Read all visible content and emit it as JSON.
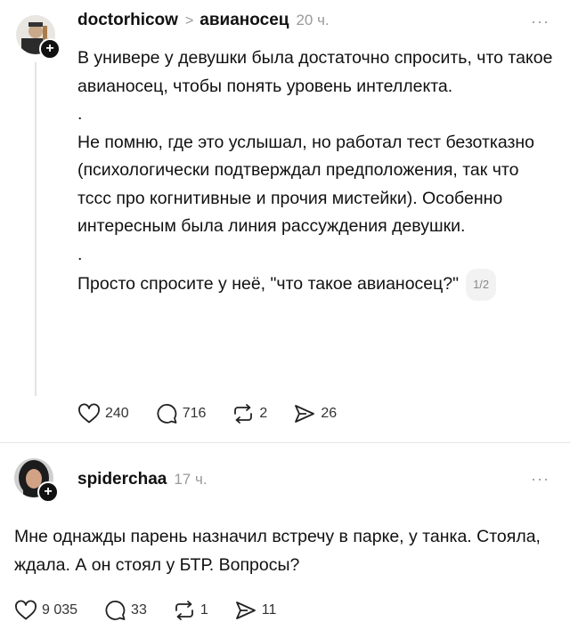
{
  "post": {
    "username": "doctorhicow",
    "chevron": ">",
    "topic": "авианосец",
    "time": "20 ч.",
    "more": "···",
    "paragraphs": [
      "В универе у девушки была достаточно спросить, что такое авианосец, чтобы понять уровень интеллекта.",
      ".",
      "Не помню, где это услышал, но работал тест безотказно (психологически подтверждал предположения, так что тссс про когнитивные и прочия мистейки). Особенно интересным была линия рассуждения девушки.",
      ".",
      "Просто спросите у неё, \"что такое авианосец?\""
    ],
    "pager": "1/2",
    "stats": {
      "likes": "240",
      "comments": "716",
      "reposts": "2",
      "shares": "26"
    }
  },
  "reply": {
    "username": "spiderchaa",
    "time": "17 ч.",
    "more": "···",
    "text": "Мне однажды парень назначил встречу в парке, у танка. Стояла, ждала. А он стоял у БТР. Вопросы?",
    "stats": {
      "likes": "9 035",
      "comments": "33",
      "reposts": "1",
      "shares": "11"
    }
  },
  "icons": {
    "like": "heart-icon",
    "comment": "comment-icon",
    "repost": "repost-icon",
    "share": "send-icon",
    "follow": "plus-icon"
  }
}
